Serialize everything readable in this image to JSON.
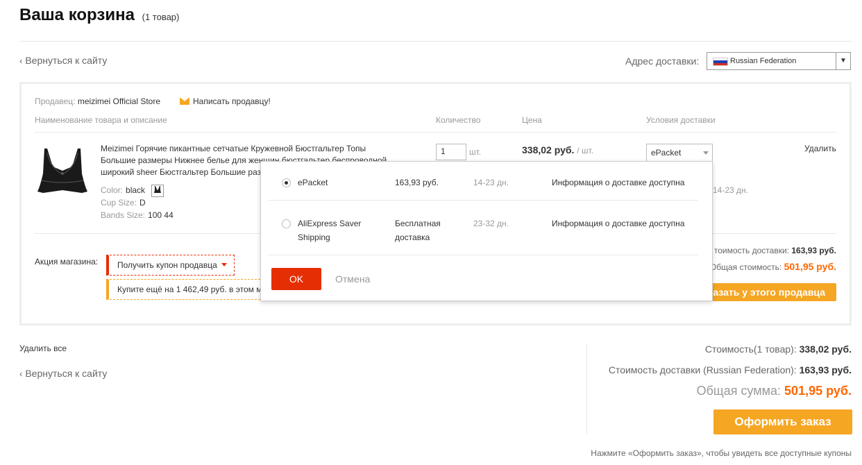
{
  "header": {
    "title": "Ваша корзина",
    "count": "(1 товар)"
  },
  "nav": {
    "back_to_site": "Вернуться к сайту"
  },
  "address": {
    "label": "Адрес доставки:",
    "country": "Russian Federation"
  },
  "seller": {
    "label": "Продавец:",
    "name": "meizimei Official Store",
    "contact": "Написать продавцу!"
  },
  "columns": {
    "name": "Наименование товара и описание",
    "qty": "Количество",
    "price": "Цена",
    "shipping": "Условия доставки"
  },
  "product": {
    "title": "Meizimei Горячие пикантные сетчатые Кружевной Бюстгальтер Топы Большие размеры Нижнее белье для женщин бюстгальтер беспроводной широкий sheer Бюстгальтер Большие размеры",
    "attributes": [
      {
        "label": "Color:",
        "value": "black"
      },
      {
        "label": "Cup Size:",
        "value": "D"
      },
      {
        "label": "Bands Size:",
        "value": "100 44"
      }
    ],
    "qty": "1",
    "qty_unit": "шт.",
    "price": "338,02 руб.",
    "price_unit": "/ шт.",
    "shipping_method": "ePacket",
    "delivery_days": "14-23 дн.",
    "delete": "Удалить"
  },
  "promo": {
    "label": "Акция магазина:",
    "coupon": "Получить купон продавца",
    "buy_more": "Купите ещё на 1 462,49 руб. в этом м"
  },
  "store_summary": {
    "shipping_label": "тоимость доставки:",
    "shipping_value": "163,93 руб.",
    "total_label": "Общая стоимость:",
    "total_value": "501,95 руб.",
    "order_button": "азать у этого продавца"
  },
  "shipping_popup": {
    "options": [
      {
        "selected": true,
        "name": "ePacket",
        "cost": "163,93 руб.",
        "days": "14-23 дн.",
        "info": "Информация о доставке доступна"
      },
      {
        "selected": false,
        "name": "AliExpress Saver Shipping",
        "cost": "Бесплатная доставка",
        "days": "23-32 дн.",
        "info": "Информация о доставке доступна"
      }
    ],
    "ok": "OK",
    "cancel": "Отмена"
  },
  "footer": {
    "delete_all": "Удалить все",
    "subtotal_label": "Стоимость(1 товар):",
    "subtotal_value": "338,02 руб.",
    "shipping_label": "Стоимость доставки (Russian Federation):",
    "shipping_value": "163,93 руб.",
    "grand_label": "Общая сумма:",
    "grand_value": "501,95 руб.",
    "checkout": "Оформить заказ",
    "note": "Нажмите «Оформить заказ», чтобы увидеть все доступные купоны"
  },
  "colors": {
    "accent_orange": "#f5a623",
    "price_orange": "#ff6600",
    "ok_red": "#e62e04"
  }
}
